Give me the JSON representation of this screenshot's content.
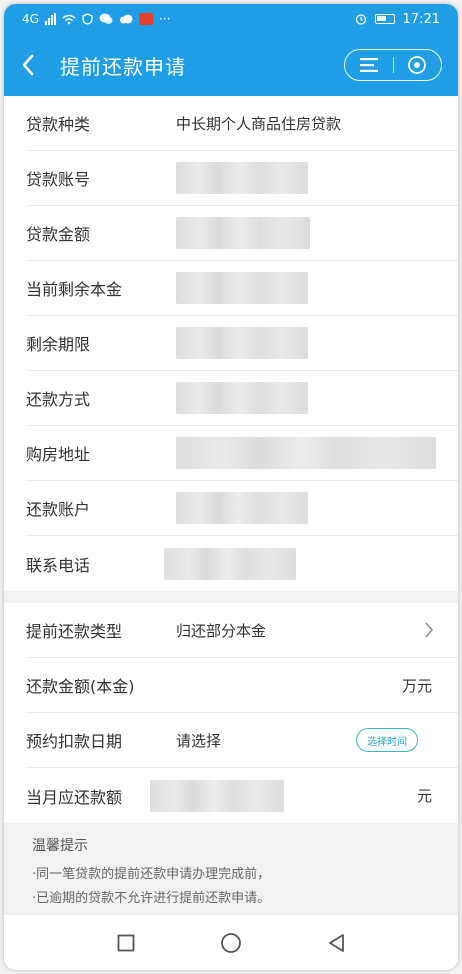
{
  "status_bar": {
    "network": "4G",
    "time": "17:21"
  },
  "header": {
    "title": "提前还款申请"
  },
  "loan_info": {
    "rows": [
      {
        "label": "贷款种类",
        "value": "中长期个人商品住房贷款"
      },
      {
        "label": "贷款账号"
      },
      {
        "label": "贷款金额"
      },
      {
        "label": "当前剩余本金"
      },
      {
        "label": "剩余期限"
      },
      {
        "label": "还款方式"
      },
      {
        "label": "购房地址"
      },
      {
        "label": "还款账户"
      },
      {
        "label": "联系电话"
      }
    ]
  },
  "repay_form": {
    "type_label": "提前还款类型",
    "type_value": "归还部分本金",
    "amount_label": "还款金额(本金)",
    "amount_unit": "万元",
    "date_label": "预约扣款日期",
    "date_placeholder": "请选择",
    "date_button": "选择时间",
    "monthly_label": "当月应还款额",
    "monthly_unit": "元"
  },
  "tips": {
    "title": "温馨提示",
    "items": [
      "·同一笔贷款的提前还款申请办理完成前，",
      "·已逾期的贷款不允许进行提前还款申请。"
    ]
  },
  "colors": {
    "primary": "#1f9ee6",
    "accent": "#2aa6c0",
    "background": "#f2f2f2"
  }
}
